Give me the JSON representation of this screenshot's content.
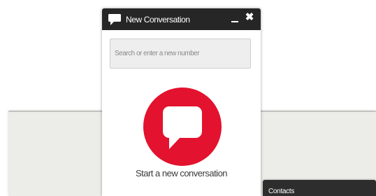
{
  "dialog": {
    "title": "New Conversation",
    "minimize_icon": "minimize-icon",
    "close_icon": "close-icon",
    "search_placeholder": "Search or enter a new number",
    "start_label": "Start a new conversation",
    "accent_color": "#e3122e",
    "titlebar_color": "#262626"
  },
  "contacts_bar": {
    "label": "Contacts"
  }
}
